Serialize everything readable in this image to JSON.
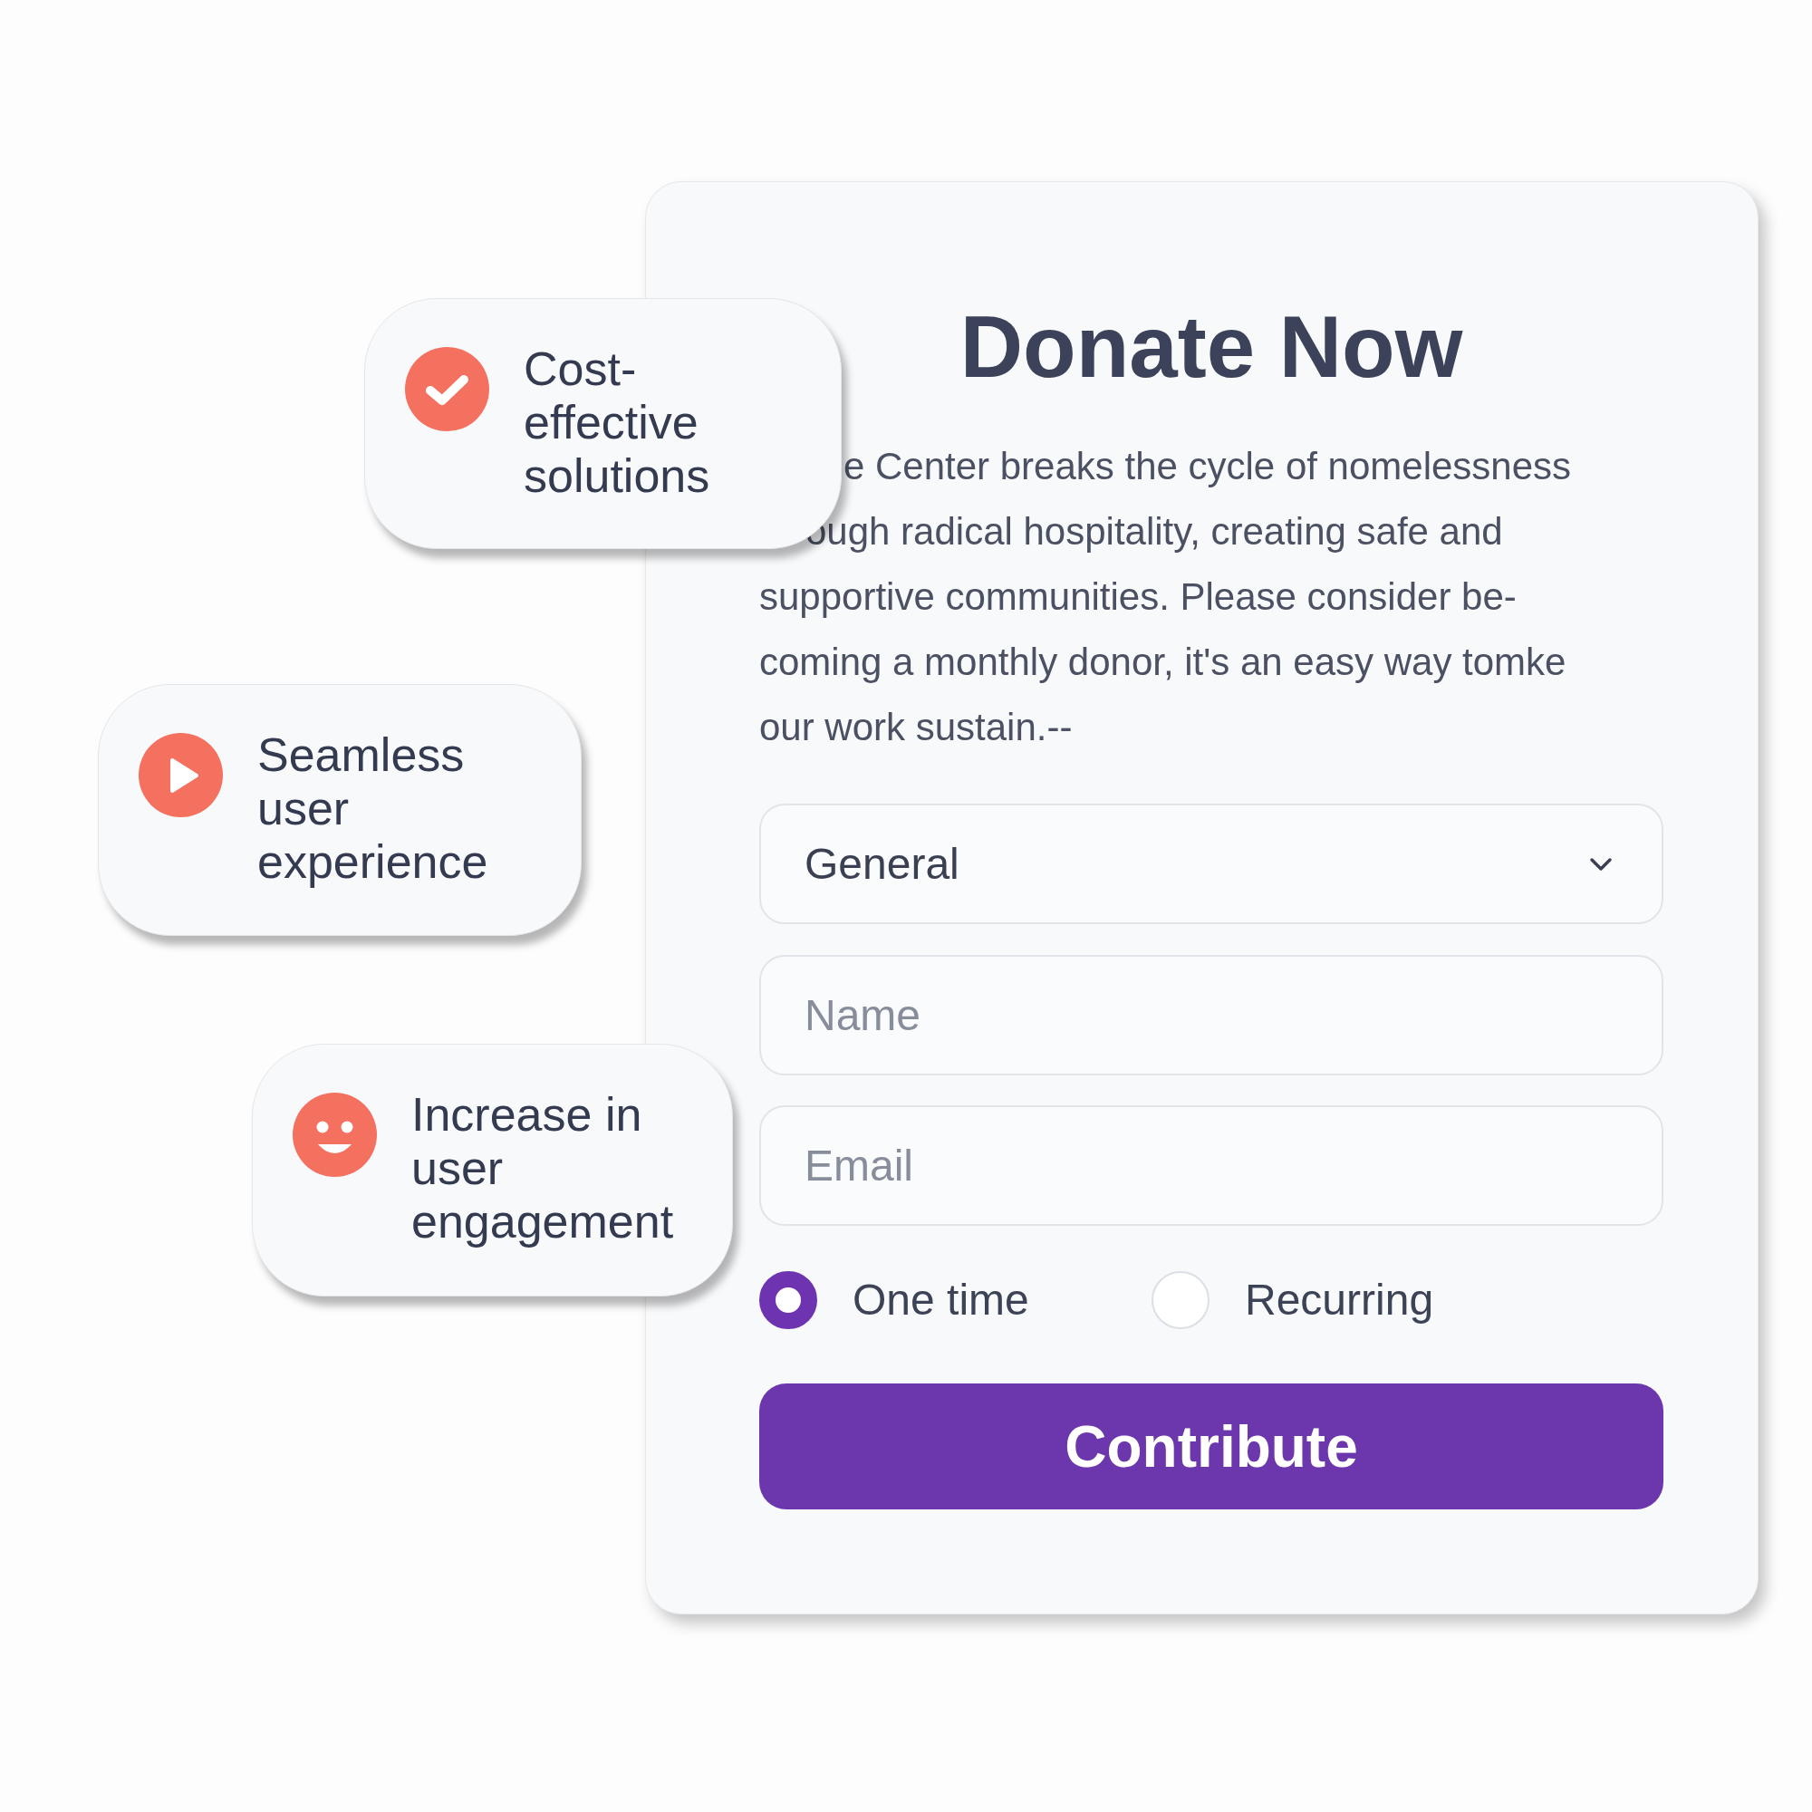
{
  "donation_form": {
    "title": "Donate Now",
    "description": "e Center breaks the cycle of nomelessness\nough radical hospitality, creating safe and\nsupportive communities. Please consider be-\ncoming a monthly donor, it's an easy way tomke\nour work sustain.--",
    "category_select": {
      "value": "General"
    },
    "name_field": {
      "placeholder": "Name"
    },
    "email_field": {
      "placeholder": "Email"
    },
    "frequency_options": [
      {
        "label": "One time",
        "selected": true
      },
      {
        "label": "Recurring",
        "selected": false
      }
    ],
    "submit_button": "Contribute"
  },
  "feature_cards": [
    {
      "kind": "check",
      "text": "Cost-effective solutions"
    },
    {
      "kind": "play",
      "text": "Seamless user experience"
    },
    {
      "kind": "smile",
      "text": "Increase in user engagement"
    }
  ]
}
